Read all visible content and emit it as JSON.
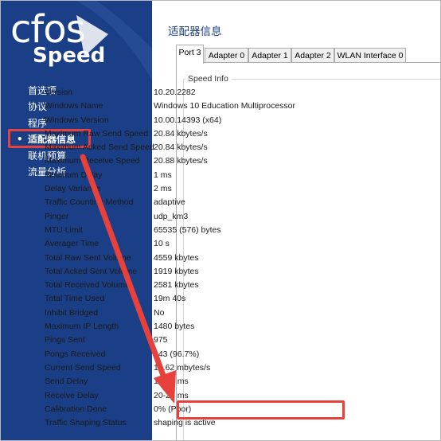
{
  "logo": {
    "line1": "cfos",
    "line2": "Speed"
  },
  "sidebar": {
    "items": [
      {
        "label": "首选项",
        "active": false
      },
      {
        "label": "协议",
        "active": false
      },
      {
        "label": "程序",
        "active": false
      },
      {
        "label": "适配器信息",
        "active": true,
        "bullet": "•"
      },
      {
        "label": "联机预算",
        "active": false
      },
      {
        "label": "流量分析",
        "active": false
      }
    ]
  },
  "main": {
    "title": "适配器信息",
    "tabs": [
      {
        "label": "Port 3",
        "active": true
      },
      {
        "label": "Adapter 0",
        "active": false
      },
      {
        "label": "Adapter 1",
        "active": false
      },
      {
        "label": "Adapter 2",
        "active": false
      },
      {
        "label": "WLAN Interface 0",
        "active": false
      }
    ],
    "group_title": "Speed Info",
    "rows": [
      {
        "label": "Version",
        "value": "10.20.2282"
      },
      {
        "label": "Windows Name",
        "value": "Windows 10 Education Multiprocessor"
      },
      {
        "label": "Windows Version",
        "value": "10.00.14393 (x64)"
      },
      {
        "label": "Maximum Raw Send Speed",
        "value": "20.84 kbytes/s"
      },
      {
        "label": "Maximum Acked Send Speed",
        "value": "20.84 kbytes/s"
      },
      {
        "label": "Maximum Receive Speed",
        "value": "20.88 kbytes/s"
      },
      {
        "label": "Minimum Delay",
        "value": "1 ms"
      },
      {
        "label": "Delay Variance",
        "value": "2 ms"
      },
      {
        "label": "Traffic Counting Method",
        "value": "adaptive"
      },
      {
        "label": "Pinger",
        "value": "udp_km3"
      },
      {
        "label": "MTU Limit",
        "value": "65535 (576) bytes"
      },
      {
        "label": "Averager Time",
        "value": "10 s"
      },
      {
        "label": "Total Raw Sent Volume",
        "value": "4559 kbytes"
      },
      {
        "label": "Total Acked Sent Volume",
        "value": "1919 kbytes"
      },
      {
        "label": "Total Received Volume",
        "value": "2581 kbytes"
      },
      {
        "label": "Total Time Used",
        "value": "19m 40s"
      },
      {
        "label": "Inhibit Bridged",
        "value": "No"
      },
      {
        "label": "Maximum IP Length",
        "value": "1480 bytes"
      },
      {
        "label": "Pings Sent",
        "value": "975"
      },
      {
        "label": "Pongs Received",
        "value": "943 (96.7%)"
      },
      {
        "label": "Current Send Speed",
        "value": "15.62 mbytes/s"
      },
      {
        "label": "Send Delay",
        "value": "10-17 ms"
      },
      {
        "label": "Receive Delay",
        "value": "20-20 ms"
      },
      {
        "label": "Calibration Done",
        "value": "0% (Poor)"
      },
      {
        "label": "Traffic Shaping Status",
        "value": "shaping is active"
      }
    ]
  },
  "colors": {
    "sidebar_bg": "#1b3f86",
    "highlight": "#e8413b",
    "title": "#1b3f86"
  }
}
